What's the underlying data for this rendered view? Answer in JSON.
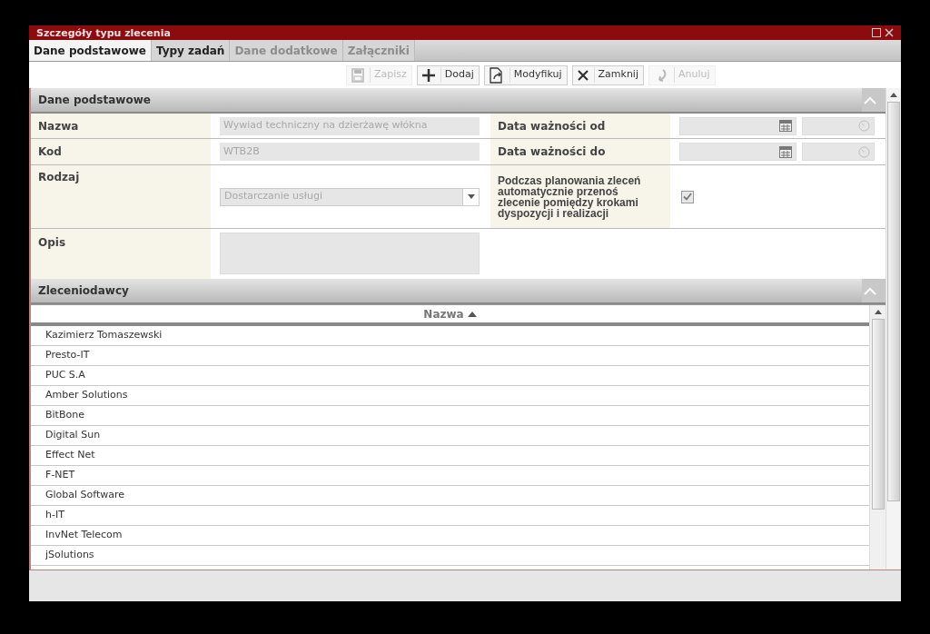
{
  "window": {
    "title": "Szczegóły typu zlecenia"
  },
  "tabs": [
    {
      "label": "Dane podstawowe",
      "selected": true,
      "disabled": false
    },
    {
      "label": "Typy zadań",
      "selected": false,
      "disabled": false
    },
    {
      "label": "Dane dodatkowe",
      "selected": false,
      "disabled": true
    },
    {
      "label": "Załączniki",
      "selected": false,
      "disabled": true
    }
  ],
  "toolbar": [
    {
      "kind": "save",
      "label": "Zapisz",
      "disabled": true
    },
    {
      "kind": "add",
      "label": "Dodaj",
      "disabled": false
    },
    {
      "kind": "edit",
      "label": "Modyfikuj",
      "disabled": false
    },
    {
      "kind": "close",
      "label": "Zamknij",
      "disabled": false
    },
    {
      "kind": "undo",
      "label": "Anuluj",
      "disabled": true
    }
  ],
  "basic_section": {
    "title": "Dane podstawowe",
    "disabled": true,
    "name": {
      "label": "Nazwa",
      "value": "Wywiad techniczny na dzierżawę włókna"
    },
    "code": {
      "label": "Kod",
      "value": "WTB2B"
    },
    "type": {
      "label": "Rodzaj",
      "value": "Dostarczanie usługi"
    },
    "description": {
      "label": "Opis"
    },
    "valid_from": {
      "label": "Data ważności od"
    },
    "valid_to": {
      "label": "Data ważności do"
    },
    "auto_move": {
      "label": "Podczas planowania zleceń automatycznie przenoś zlecenie pomiędzy krokami dyspozycji i realizacji",
      "checked": true
    }
  },
  "clients_section": {
    "title": "Zleceniodawcy",
    "column": {
      "label": "Nazwa",
      "sorted_ascending": true
    },
    "rows": [
      "Kazimierz Tomaszewski",
      "Presto-IT",
      "PUC S.A",
      "Amber Solutions",
      "BitBone",
      "Digital Sun",
      "Effect Net",
      "F-NET",
      "Global Software",
      "h-IT",
      "InvNet Telecom",
      "jSolutions"
    ]
  }
}
